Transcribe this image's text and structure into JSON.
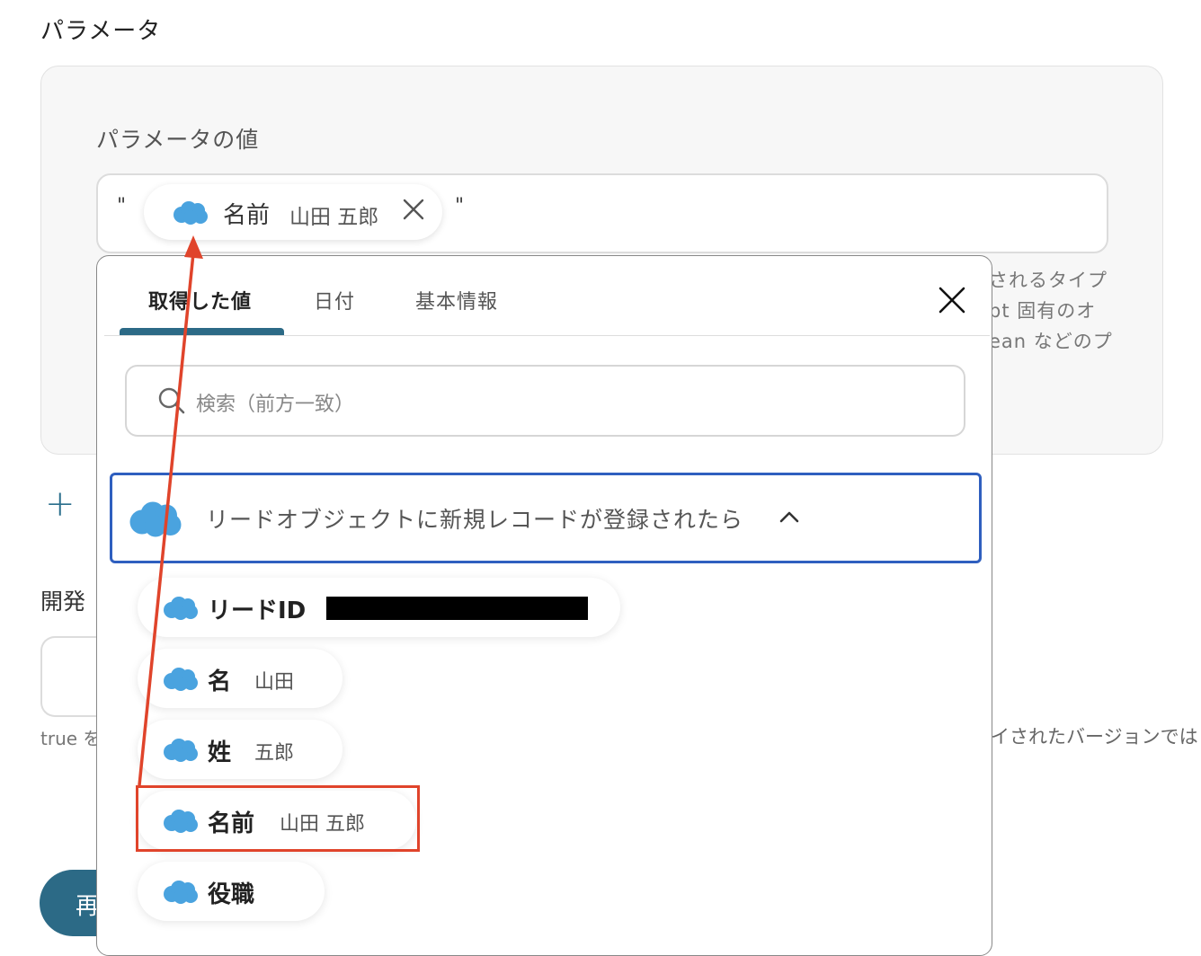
{
  "section_title": "パラメータ",
  "param_label": "パラメータの値",
  "value_field": {
    "quote_open": "\"",
    "quote_close": "\"",
    "chip": {
      "icon": "salesforce-cloud-icon",
      "key": "名前",
      "value": "山田 五郎"
    }
  },
  "help_lines": [
    "されるタイプ",
    "pt 固有のオ",
    "ean などのプ"
  ],
  "add_symbol": "+",
  "dev_label": "開発",
  "true_text": "true を",
  "right_note": "イされたバージョンでは",
  "run_button_label": "再",
  "popup": {
    "tabs": [
      {
        "label": "取得した値",
        "active": true
      },
      {
        "label": "日付",
        "active": false
      },
      {
        "label": "基本情報",
        "active": false
      }
    ],
    "search_placeholder": "検索（前方一致）",
    "group": {
      "icon": "salesforce-cloud-icon",
      "label": "リードオブジェクトに新規レコードが登録されたら",
      "expanded": true
    },
    "items": [
      {
        "key": "リードID",
        "value": "",
        "redacted": true
      },
      {
        "key": "名",
        "value": "山田"
      },
      {
        "key": "姓",
        "value": "五郎"
      },
      {
        "key": "名前",
        "value": "山田 五郎",
        "highlighted": true
      },
      {
        "key": "役職",
        "value": ""
      }
    ]
  },
  "colors": {
    "accent": "#2c6a86",
    "salesforce_blue": "#4aa3df",
    "highlight_red": "#e0442b",
    "group_border": "#2f5fbf"
  }
}
